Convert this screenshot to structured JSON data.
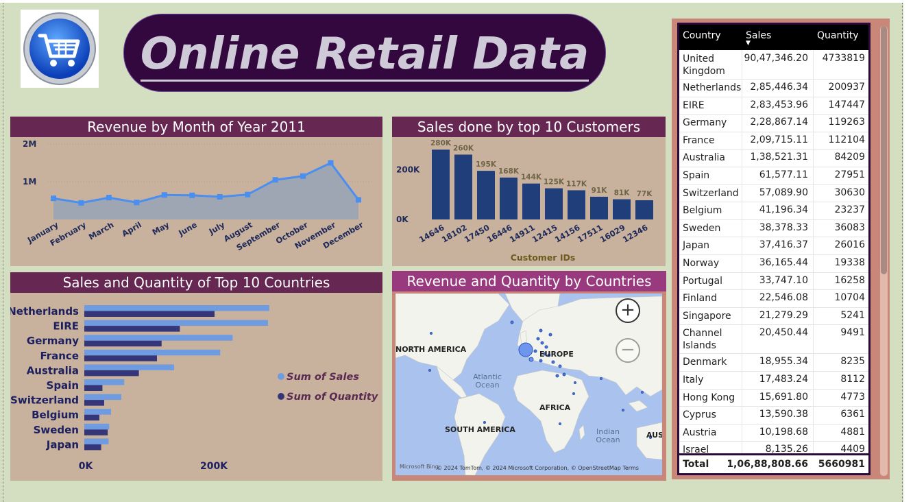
{
  "dashboard": {
    "title": "Online Retail Data",
    "logo_icon": "shopping-cart-icon"
  },
  "colors": {
    "background": "#d3dfc0",
    "panel": "#c9b29d",
    "title_bar": "#662752",
    "bar_dark": "#1f3e7a",
    "line": "#4a8ef0",
    "sales_bar": "#6f9be0",
    "quantity_bar": "#35367a"
  },
  "chart_data": [
    {
      "type": "line",
      "title": "Revenue by Month of Year 2011",
      "categories": [
        "January",
        "February",
        "March",
        "April",
        "May",
        "June",
        "July",
        "August",
        "September",
        "October",
        "November",
        "December"
      ],
      "values": [
        560000,
        440000,
        580000,
        450000,
        650000,
        640000,
        600000,
        660000,
        1050000,
        1150000,
        1500000,
        520000
      ],
      "y_tick_labels": [
        "1M",
        "2M"
      ],
      "ylim": [
        0,
        2000000
      ]
    },
    {
      "type": "bar",
      "title": "Sales done by top 10 Customers",
      "categories": [
        "14646",
        "18102",
        "17450",
        "16446",
        "14911",
        "12415",
        "14156",
        "17511",
        "16029",
        "12346"
      ],
      "values": [
        280000,
        260000,
        195000,
        168000,
        144000,
        125000,
        117000,
        91000,
        81000,
        77000
      ],
      "data_labels": [
        "280K",
        "260K",
        "195K",
        "168K",
        "144K",
        "125K",
        "117K",
        "91K",
        "81K",
        "77K"
      ],
      "y_tick_labels": [
        "0K",
        "200K"
      ],
      "xlabel": "Customer IDs",
      "ylim": [
        0,
        330000
      ]
    },
    {
      "type": "bar",
      "orientation": "horizontal",
      "title": "Sales and Quantity of Top 10 Countries",
      "categories": [
        "Netherlands",
        "EIRE",
        "Germany",
        "France",
        "Australia",
        "Spain",
        "Switzerland",
        "Belgium",
        "Sweden",
        "Japan"
      ],
      "series": [
        {
          "name": "Sum of Sales",
          "values": [
            285446.34,
            283453.96,
            228867.14,
            209715.11,
            138521.31,
            61577.11,
            57089.9,
            41196.34,
            38378.33,
            37416.37
          ]
        },
        {
          "name": "Sum of Quantity",
          "values": [
            200937,
            147447,
            119263,
            112104,
            84209,
            27951,
            30630,
            23237,
            36083,
            26016
          ]
        }
      ],
      "x_tick_labels": [
        "0K",
        "200K"
      ],
      "xlim": [
        0,
        330000
      ],
      "legend": "right"
    }
  ],
  "map": {
    "title": "Revenue and Quantity by Countries",
    "labels": {
      "north_america": "NORTH AMERICA",
      "europe": "EUROPE",
      "africa": "AFRICA",
      "south_america": "SOUTH AMERICA",
      "australia": "AUS",
      "atlantic": "Atlantic Ocean",
      "indian": "Indian Ocean"
    },
    "attribution": "© 2024 TomTom, © 2024 Microsoft Corporation, © OpenStreetMap  Terms",
    "brand": "Microsoft Bing",
    "zoom_in_icon": "zoom-in-icon",
    "zoom_out_icon": "zoom-out-icon"
  },
  "table": {
    "headers": [
      "Country",
      "Sales",
      "Quantity"
    ],
    "rows": [
      [
        "United Kingdom",
        "90,47,346.20",
        "4733819"
      ],
      [
        "Netherlands",
        "2,85,446.34",
        "200937"
      ],
      [
        "EIRE",
        "2,83,453.96",
        "147447"
      ],
      [
        "Germany",
        "2,28,867.14",
        "119263"
      ],
      [
        "France",
        "2,09,715.11",
        "112104"
      ],
      [
        "Australia",
        "1,38,521.31",
        "84209"
      ],
      [
        "Spain",
        "61,577.11",
        "27951"
      ],
      [
        "Switzerland",
        "57,089.90",
        "30630"
      ],
      [
        "Belgium",
        "41,196.34",
        "23237"
      ],
      [
        "Sweden",
        "38,378.33",
        "36083"
      ],
      [
        "Japan",
        "37,416.37",
        "26016"
      ],
      [
        "Norway",
        "36,165.44",
        "19338"
      ],
      [
        "Portugal",
        "33,747.10",
        "16258"
      ],
      [
        "Finland",
        "22,546.08",
        "10704"
      ],
      [
        "Singapore",
        "21,279.29",
        "5241"
      ],
      [
        "Channel Islands",
        "20,450.44",
        "9491"
      ],
      [
        "Denmark",
        "18,955.34",
        "8235"
      ],
      [
        "Italy",
        "17,483.24",
        "8112"
      ],
      [
        "Hong Kong",
        "15,691.80",
        "4773"
      ],
      [
        "Cyprus",
        "13,590.38",
        "6361"
      ],
      [
        "Austria",
        "10,198.68",
        "4881"
      ],
      [
        "Israel",
        "8,135.26",
        "4409"
      ]
    ],
    "total": {
      "label": "Total",
      "sales": "1,06,88,808.66",
      "quantity": "5660981"
    },
    "sort_icon": "sort-desc-icon"
  }
}
